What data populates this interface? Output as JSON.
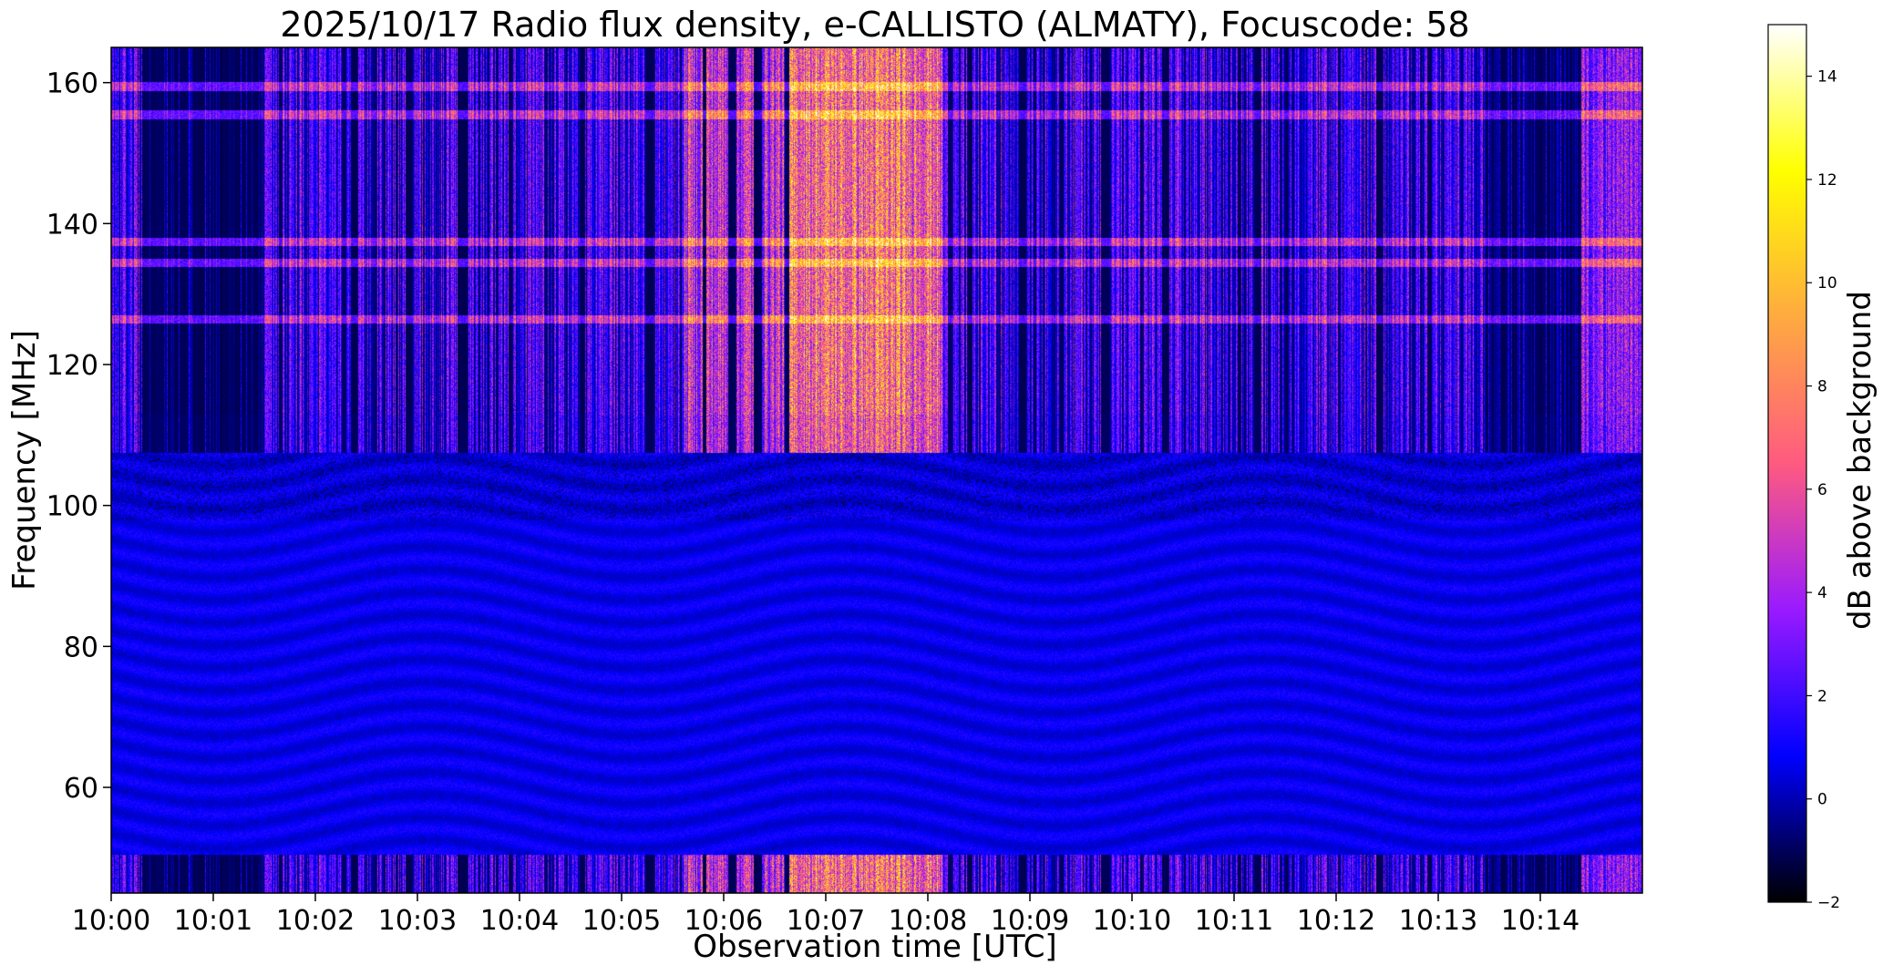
{
  "chart_data": {
    "type": "heatmap",
    "title": "2025/10/17  Radio flux density, e-CALLISTO (ALMATY), Focuscode: 58",
    "xlabel": "Observation time [UTC]",
    "ylabel": "Frequency [MHz]",
    "xlim": [
      "10:00",
      "10:15"
    ],
    "ylim": [
      45,
      165
    ],
    "xticks": [
      "10:00",
      "10:01",
      "10:02",
      "10:03",
      "10:04",
      "10:05",
      "10:06",
      "10:07",
      "10:08",
      "10:09",
      "10:10",
      "10:11",
      "10:12",
      "10:13",
      "10:14"
    ],
    "yticks": [
      60,
      80,
      100,
      120,
      140,
      160
    ],
    "colorbar": {
      "label": "dB above background",
      "range": [
        -2,
        15
      ],
      "ticks": [
        -2,
        0,
        2,
        4,
        6,
        8,
        10,
        12,
        14
      ],
      "colormap": "gnuplot2",
      "colors": [
        "#000000",
        "#0000ff",
        "#9a1aff",
        "#ff5a80",
        "#ffaa40",
        "#ffff00",
        "#ffffff"
      ]
    },
    "features": {
      "quiet_band_mhz": [
        50.5,
        107.5
      ],
      "strong_emission_minutes": [
        5.6,
        8.15
      ],
      "dark_gap_minutes": [
        [
          0.3,
          1.5
        ],
        [
          13.45,
          14.4
        ]
      ],
      "rfi_lines_mhz": [
        159.5,
        155.5,
        137.5,
        134.5,
        126.5
      ]
    }
  }
}
